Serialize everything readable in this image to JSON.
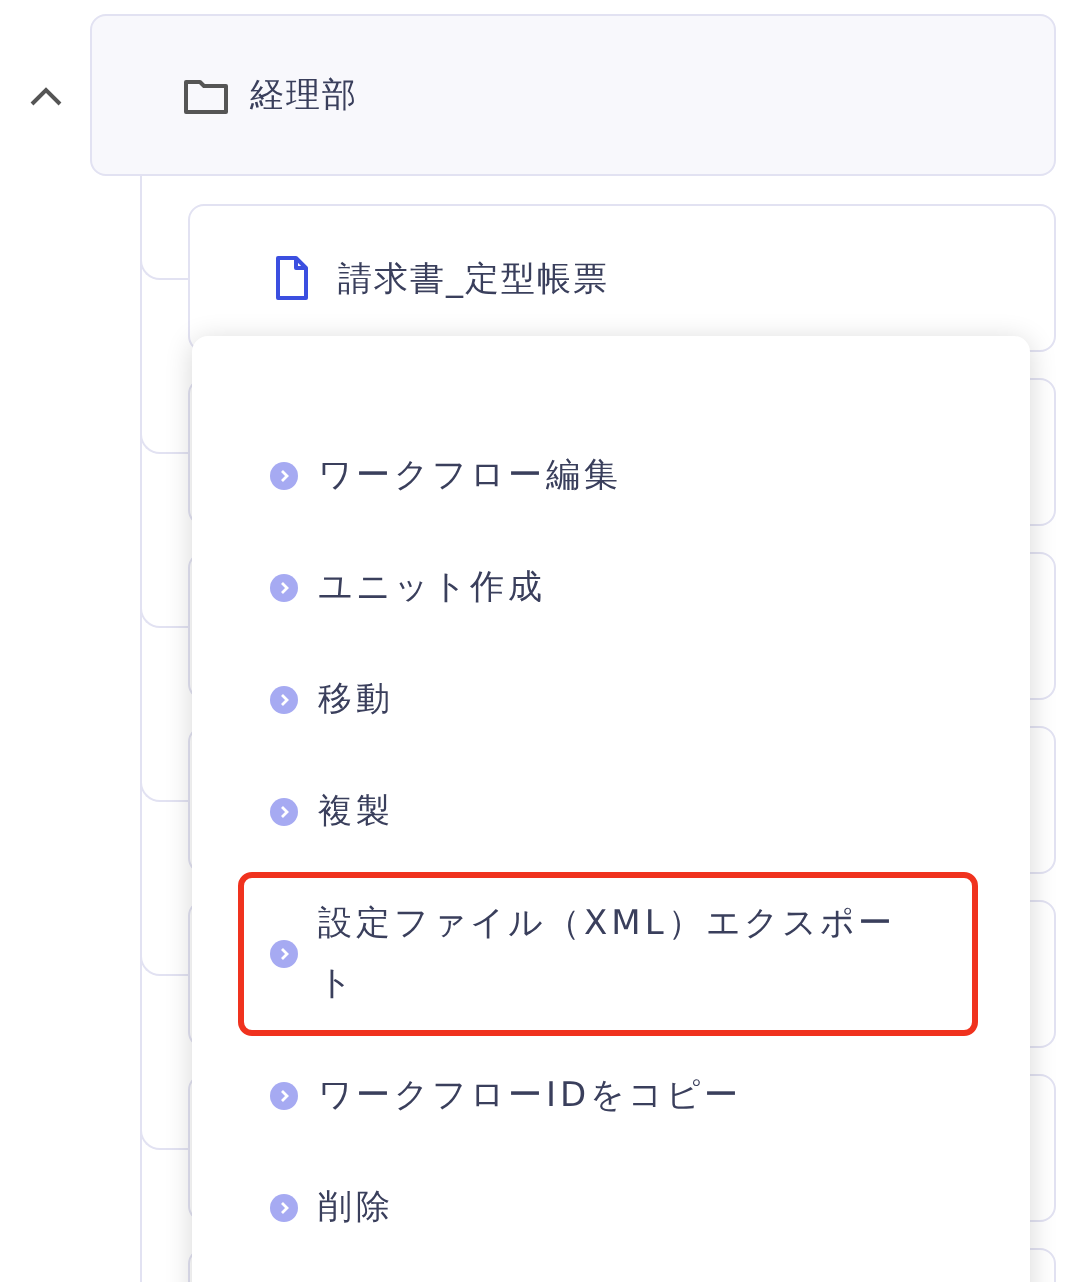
{
  "folder": {
    "name": "経理部",
    "expanded": true
  },
  "children": [
    {
      "name": "請求書_定型帳票"
    }
  ],
  "context_menu": {
    "items": [
      {
        "label": "ワークフロー編集",
        "highlighted": false
      },
      {
        "label": "ユニット作成",
        "highlighted": false
      },
      {
        "label": "移動",
        "highlighted": false
      },
      {
        "label": "複製",
        "highlighted": false
      },
      {
        "label": "設定ファイル（XML）エクスポート",
        "highlighted": true
      },
      {
        "label": "ワークフローIDをコピー",
        "highlighted": false
      },
      {
        "label": "削除",
        "highlighted": false
      }
    ]
  }
}
